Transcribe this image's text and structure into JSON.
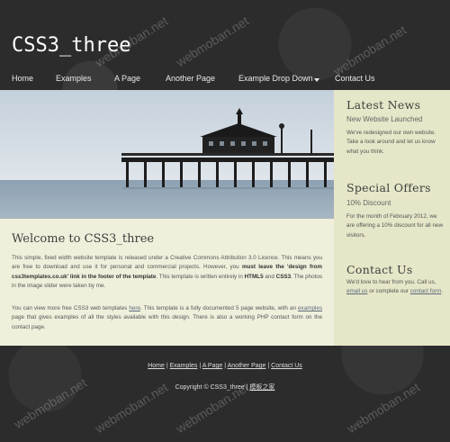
{
  "site": {
    "logo": "CSS3_three"
  },
  "nav": {
    "items": [
      "Home",
      "Examples",
      "A Page",
      "Another Page",
      "Example Drop Down",
      "Contact Us"
    ]
  },
  "main": {
    "title": "Welcome to CSS3_three",
    "para1_a": "This simple, fixed width website template is released under a Creative Commons Attribution 3.0 Licence. This means you are free to download and use it for personal and commercial projects. However, you ",
    "para1_b": "must leave the 'design from css3templates.co.uk' link in the footer of the template",
    "para1_c": ". This template is written entirely in ",
    "para1_d": "HTML5",
    "para1_e": " and ",
    "para1_f": "CSS3",
    "para1_g": ". The photos in the image slider were taken by me.",
    "para2_a": "You can view more free CSS3 web templates ",
    "para2_link1": "here",
    "para2_b": ". This template is a fully documented 5 page website, with an ",
    "para2_link2": "examples",
    "para2_c": " page that gives examples of all the styles available with this design. There is also a working PHP contact form on the contact page."
  },
  "sidebar": {
    "news_title": "Latest News",
    "news_sub": "New Website Launched",
    "news_text": "We've redesigned our own website. Take a look around and let us know what you think.",
    "offers_title": "Special Offers",
    "offers_sub": "10% Discount",
    "offers_text": "For the month of February 2012, we are offering a 10% discount for all new visitors.",
    "contact_title": "Contact Us",
    "contact_a": "We'd love to hear from you. Call us, ",
    "contact_link1": "email us",
    "contact_b": " or complete our ",
    "contact_link2": "contact form",
    "contact_c": "."
  },
  "footer": {
    "links": [
      "Home",
      "Examples",
      "A Page",
      "Another Page",
      "Contact Us"
    ],
    "sep": "|",
    "copyright": "Copyright © CSS3_three |",
    "credit": "模板之家"
  },
  "watermark": "webmoban.net"
}
